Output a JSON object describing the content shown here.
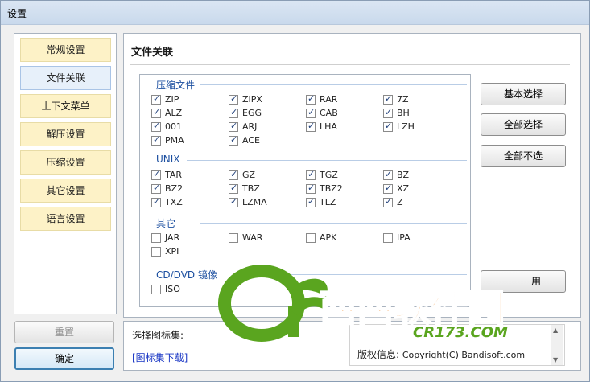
{
  "window": {
    "title": "设置"
  },
  "sidebar": {
    "items": [
      {
        "label": "常规设置"
      },
      {
        "label": "文件关联",
        "active": true
      },
      {
        "label": "上下文菜单"
      },
      {
        "label": "解压设置"
      },
      {
        "label": "压缩设置"
      },
      {
        "label": "其它设置"
      },
      {
        "label": "语言设置"
      }
    ],
    "reset_label": "重置",
    "ok_label": "确定"
  },
  "main": {
    "section_title": "文件关联",
    "groups": [
      {
        "label": "压缩文件",
        "items": [
          {
            "ext": "ZIP",
            "checked": true
          },
          {
            "ext": "ZIPX",
            "checked": true
          },
          {
            "ext": "RAR",
            "checked": true
          },
          {
            "ext": "7Z",
            "checked": true
          },
          {
            "ext": "ALZ",
            "checked": true
          },
          {
            "ext": "EGG",
            "checked": true
          },
          {
            "ext": "CAB",
            "checked": true
          },
          {
            "ext": "BH",
            "checked": true
          },
          {
            "ext": "001",
            "checked": true
          },
          {
            "ext": "ARJ",
            "checked": true
          },
          {
            "ext": "LHA",
            "checked": true
          },
          {
            "ext": "LZH",
            "checked": true
          },
          {
            "ext": "PMA",
            "checked": true
          },
          {
            "ext": "ACE",
            "checked": true
          }
        ]
      },
      {
        "label": "UNIX",
        "items": [
          {
            "ext": "TAR",
            "checked": true
          },
          {
            "ext": "GZ",
            "checked": true
          },
          {
            "ext": "TGZ",
            "checked": true
          },
          {
            "ext": "BZ",
            "checked": true
          },
          {
            "ext": "BZ2",
            "checked": true
          },
          {
            "ext": "TBZ",
            "checked": true
          },
          {
            "ext": "TBZ2",
            "checked": true
          },
          {
            "ext": "XZ",
            "checked": true
          },
          {
            "ext": "TXZ",
            "checked": true
          },
          {
            "ext": "LZMA",
            "checked": true
          },
          {
            "ext": "TLZ",
            "checked": true
          },
          {
            "ext": "Z",
            "checked": true
          }
        ]
      },
      {
        "label": "其它",
        "items": [
          {
            "ext": "JAR",
            "checked": false
          },
          {
            "ext": "WAR",
            "checked": false
          },
          {
            "ext": "APK",
            "checked": false
          },
          {
            "ext": "IPA",
            "checked": false
          },
          {
            "ext": "XPI",
            "checked": false
          }
        ]
      },
      {
        "label": "CD/DVD 镜像",
        "items": [
          {
            "ext": "ISO",
            "checked": false
          }
        ]
      }
    ],
    "buttons": {
      "basic_select": "基本选择",
      "select_all": "全部选择",
      "select_none": "全部不选",
      "apply_partial": "用"
    }
  },
  "bottom": {
    "icon_set_label": "选择图标集:",
    "download_link": "[图标集下载]",
    "copyright_label": "版权信息:",
    "copyright_value": "Copyright(C) Bandisoft.com"
  },
  "watermark": {
    "logo_text": "Cr",
    "brand_text": "西西软件园",
    "brand_url": "CR173.COM"
  },
  "colors": {
    "nav_bg": "#fdf2c7",
    "nav_active_bg": "#e7f0fa",
    "group_label": "#1c4fa0",
    "link": "#1a37c5",
    "watermark_green": "#5aa51f",
    "watermark_orange": "#f07e14"
  }
}
